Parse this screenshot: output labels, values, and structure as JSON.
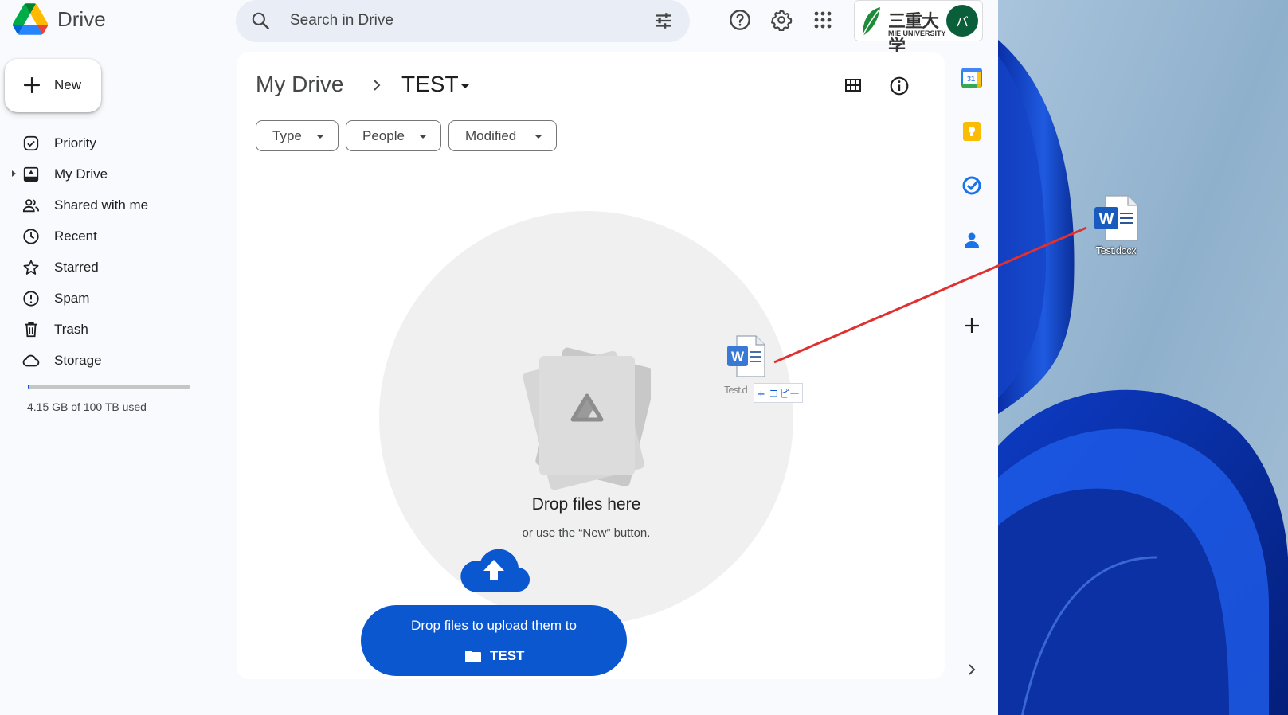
{
  "app": {
    "name": "Drive"
  },
  "search": {
    "placeholder": "Search in Drive"
  },
  "header": {
    "icons": [
      "search-icon",
      "tune-icon",
      "help-icon",
      "settings-icon",
      "apps-grid-icon"
    ],
    "org": {
      "name": "三重大学",
      "sub": "MIE UNIVERSITY"
    },
    "avatar": "バ"
  },
  "new_button": {
    "label": "New"
  },
  "nav": {
    "items": [
      {
        "label": "Priority",
        "icon": "priority-icon"
      },
      {
        "label": "My Drive",
        "icon": "my-drive-icon"
      },
      {
        "label": "Shared with me",
        "icon": "shared-icon"
      },
      {
        "label": "Recent",
        "icon": "recent-icon"
      },
      {
        "label": "Starred",
        "icon": "star-icon"
      },
      {
        "label": "Spam",
        "icon": "spam-icon"
      },
      {
        "label": "Trash",
        "icon": "trash-icon"
      },
      {
        "label": "Storage",
        "icon": "cloud-icon"
      }
    ]
  },
  "storage": {
    "text": "4.15 GB of 100 TB used",
    "used_fraction": 0.01
  },
  "breadcrumb": {
    "root": "My Drive",
    "current": "TEST"
  },
  "filters": [
    {
      "label": "Type"
    },
    {
      "label": "People"
    },
    {
      "label": "Modified"
    }
  ],
  "dropzone": {
    "title": "Drop files here",
    "subtitle": "or use the “New” button."
  },
  "upload_banner": {
    "line1": "Drop files to upload them to",
    "folder": "TEST"
  },
  "drag": {
    "ghost_label": "Test.d",
    "copy_tag": "+ コピー"
  },
  "desktop": {
    "file_label": "Test.docx"
  },
  "colors": {
    "accent": "#0b57d0",
    "drag_line": "#e03030",
    "avatar_bg": "#0b5e3a"
  }
}
